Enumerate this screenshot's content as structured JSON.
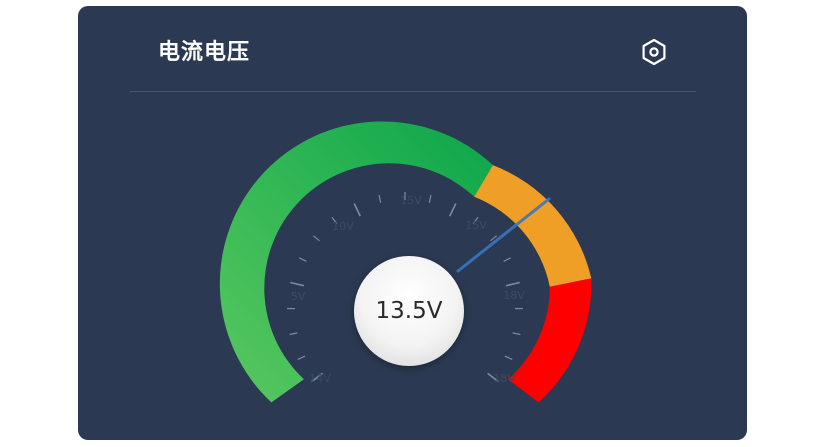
{
  "card": {
    "title": "电流电压"
  },
  "icons": {
    "settings": "hexagon-settings-icon"
  },
  "gauge": {
    "readout": "13.5V",
    "value": 13.5,
    "unit": "V",
    "colors": {
      "normal_start": "#5ac85f",
      "normal_end": "#0ba64b",
      "warning": "#f09f26",
      "danger": "#ff0000",
      "needle": "#3a76c4",
      "ticks": "#7d8aa0"
    }
  }
}
